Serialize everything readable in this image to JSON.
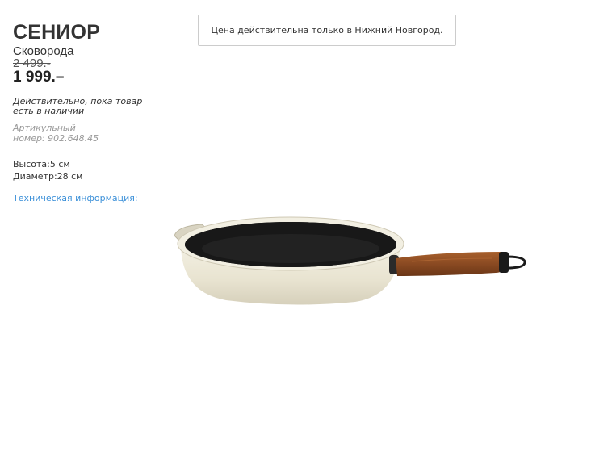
{
  "product": {
    "name": "СЕНИОР",
    "type": "Сковорода",
    "old_price": "2 499.-",
    "price": "1 999.–",
    "availability": "Действительно, пока товар есть в наличии",
    "article_label": "Артикульный номер: 902.648.45"
  },
  "dimensions": [
    {
      "text": "Высота:5 см"
    },
    {
      "text": "Диаметр:28 см"
    }
  ],
  "tech_info_link": "Техническая информация:",
  "price_note": "Цена действительна только в Нижний Новгород.",
  "image": {
    "icon": "frying-pan-image"
  },
  "colors": {
    "link": "#3a8fd8",
    "pan_body": "#ece8d8",
    "pan_inner": "#1c1c1c",
    "handle_wood": "#8a4a22"
  }
}
